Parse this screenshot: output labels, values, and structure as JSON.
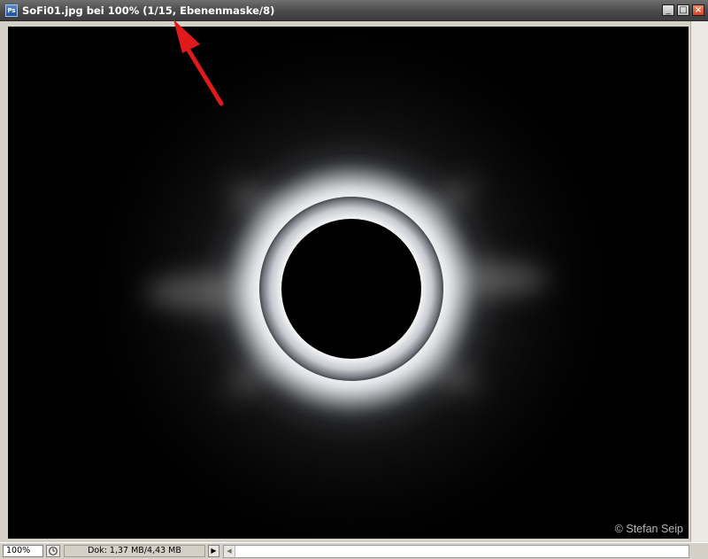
{
  "window": {
    "app_icon_label": "Ps",
    "title": "SoFi01.jpg bei 100% (1/15, Ebenenmaske/8)",
    "minimize_glyph": "_",
    "maximize_glyph": "□",
    "close_glyph": "×"
  },
  "image": {
    "subject": "total solar eclipse corona",
    "copyright": "© Stefan Seip"
  },
  "annotation": {
    "arrow_color": "#e01a1a"
  },
  "statusbar": {
    "zoom": "100%",
    "doc_info": "Dok: 1,37 MB/4,43 MB",
    "arrow_glyph": "▶"
  },
  "colors": {
    "titlebar": "#4a4a4a",
    "close_button": "#d8421d",
    "canvas_background": "#000000"
  }
}
